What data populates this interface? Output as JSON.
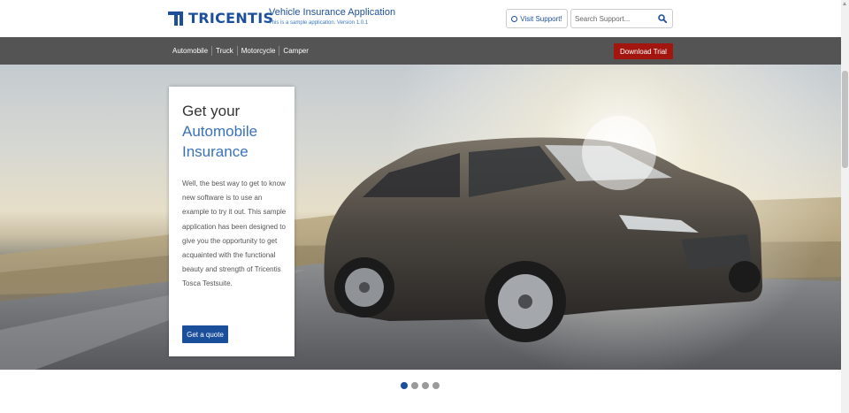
{
  "header": {
    "logo_text": "TRICENTIS",
    "app_title": "Vehicle Insurance Application",
    "app_subtitle": "This is a sample application. Version 1.0.1",
    "visit_support_label": "Visit Support!",
    "search_placeholder": "Search Support..."
  },
  "nav": {
    "items": [
      {
        "label": "Automobile"
      },
      {
        "label": "Truck"
      },
      {
        "label": "Motorcycle"
      },
      {
        "label": "Camper"
      }
    ],
    "download_label": "Download Trial"
  },
  "hero": {
    "title_line1": "Get your",
    "title_line2": "Automobile",
    "title_line3": "Insurance",
    "description": "Well, the best way to get to know new software is to use an example to try it out. This sample application has been designed to give you the opportunity to get acquainted with the functional beauty and strength of Tricentis Tosca Testsuite.",
    "cta_label": "Get a quote"
  },
  "carousel": {
    "active_index": 0,
    "count": 4
  },
  "colors": {
    "brand_blue": "#1b4f9c",
    "accent_blue": "#3a72b8",
    "download_red": "#a3150f",
    "nav_bg": "#545454"
  },
  "icons": {
    "support": "lifebuoy-icon",
    "search": "search-icon"
  }
}
